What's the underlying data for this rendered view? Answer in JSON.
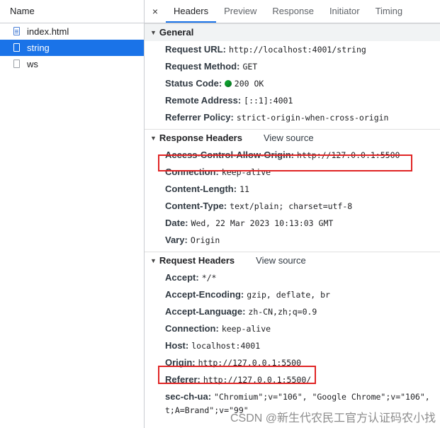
{
  "left_panel": {
    "header": "Name",
    "requests": [
      {
        "name": "index.html",
        "icon": "document-icon"
      },
      {
        "name": "string",
        "icon": "file-icon",
        "selected": true
      },
      {
        "name": "ws",
        "icon": "file-icon"
      }
    ]
  },
  "tabs": {
    "close": "×",
    "items": [
      "Headers",
      "Preview",
      "Response",
      "Initiator",
      "Timing"
    ],
    "active": "Headers"
  },
  "general": {
    "title": "General",
    "rows": [
      {
        "key": "Request URL:",
        "value": "http://localhost:4001/string"
      },
      {
        "key": "Request Method:",
        "value": "GET"
      },
      {
        "key": "Status Code:",
        "value": "200 OK",
        "status_color": "#0d9f2e"
      },
      {
        "key": "Remote Address:",
        "value": "[::1]:4001"
      },
      {
        "key": "Referrer Policy:",
        "value": "strict-origin-when-cross-origin"
      }
    ]
  },
  "response_headers": {
    "title": "Response Headers",
    "view_source": "View source",
    "rows": [
      {
        "key": "Access-Control-Allow-Origin:",
        "value": "http://127.0.0.1:5500"
      },
      {
        "key": "Connection:",
        "value": "keep-alive"
      },
      {
        "key": "Content-Length:",
        "value": "11"
      },
      {
        "key": "Content-Type:",
        "value": "text/plain; charset=utf-8"
      },
      {
        "key": "Date:",
        "value": "Wed, 22 Mar 2023 10:13:03 GMT"
      },
      {
        "key": "Vary:",
        "value": "Origin"
      }
    ]
  },
  "request_headers": {
    "title": "Request Headers",
    "view_source": "View source",
    "rows": [
      {
        "key": "Accept:",
        "value": "*/*"
      },
      {
        "key": "Accept-Encoding:",
        "value": "gzip, deflate, br"
      },
      {
        "key": "Accept-Language:",
        "value": "zh-CN,zh;q=0.9"
      },
      {
        "key": "Connection:",
        "value": "keep-alive"
      },
      {
        "key": "Host:",
        "value": "localhost:4001"
      },
      {
        "key": "Origin:",
        "value": "http://127.0.0.1:5500"
      },
      {
        "key": "Referer:",
        "value": "http://127.0.0.1:5500/"
      },
      {
        "key": "sec-ch-ua:",
        "value": "\"Chromium\";v=\"106\", \"Google Chrome\";v=\"106\","
      },
      {
        "key": "",
        "value": "t;A=Brand\";v=\"99\""
      }
    ]
  },
  "watermark": "CSDN @新生代农民工官方认证码农小找",
  "highlight_color": "#e02424"
}
